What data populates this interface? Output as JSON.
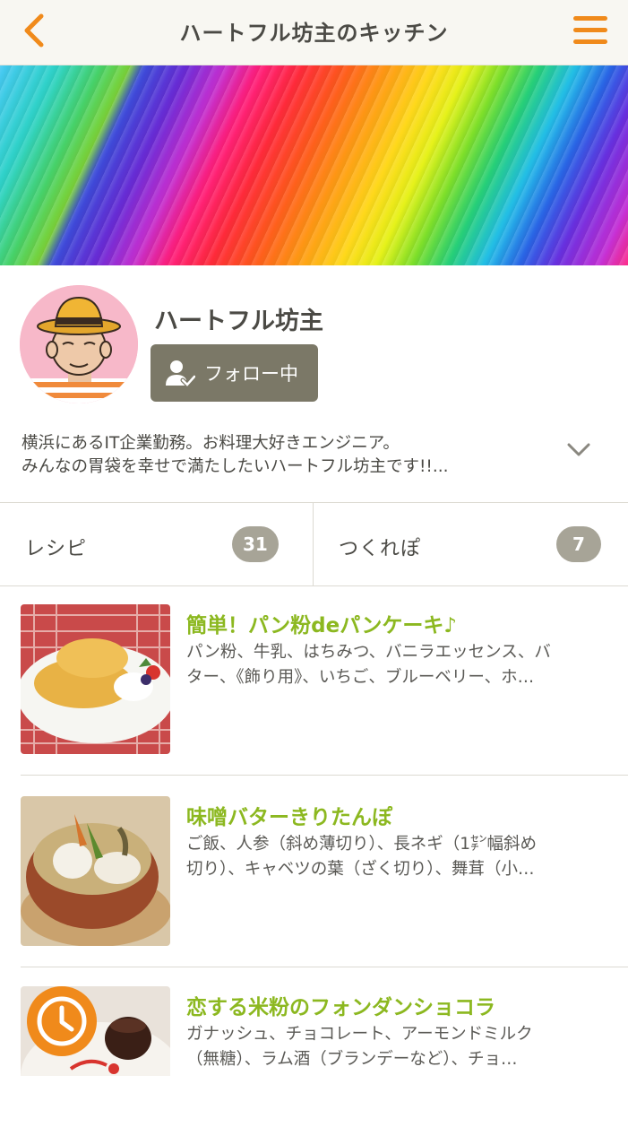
{
  "header": {
    "title": "ハートフル坊主のキッチン",
    "back_icon": "chevron-left-icon",
    "menu_icon": "hamburger-menu-icon",
    "accent_color": "#f08a1b"
  },
  "profile": {
    "name": "ハートフル坊主",
    "follow_label": "フォロー中",
    "bio_line1": "横浜にあるIT企業勤務。お料理大好きエンジニア。",
    "bio_line2": "みんなの胃袋を幸せで満たしたいハートフル坊主です!!..."
  },
  "tabs": [
    {
      "label": "レシピ",
      "count": "31"
    },
    {
      "label": "つくれぽ",
      "count": "7"
    }
  ],
  "recipes": [
    {
      "title": "簡単！パン粉deパンケーキ♪",
      "desc_line1": "パン粉、牛乳、はちみつ、バニラエッセンス、バ",
      "desc_line2": "ター、《飾り用》、いちご、ブルーベリー、ホ…"
    },
    {
      "title": "味噌バターきりたんぽ",
      "desc_line1": "ご飯、人参（斜め薄切り）、長ネギ（1㌢幅斜め",
      "desc_line2": "切り）、キャベツの葉（ざく切り）、舞茸（小…"
    },
    {
      "title": "恋する米粉のフォンダンショコラ",
      "desc_line1": "ガナッシュ、チョコレート、アーモンドミルク",
      "desc_line2": "（無糖）、ラム酒（ブランデーなど）、チョ…"
    }
  ],
  "colors": {
    "recipe_title": "#8cb820",
    "follow_button": "#7b7867",
    "count_badge": "#a7a497"
  }
}
